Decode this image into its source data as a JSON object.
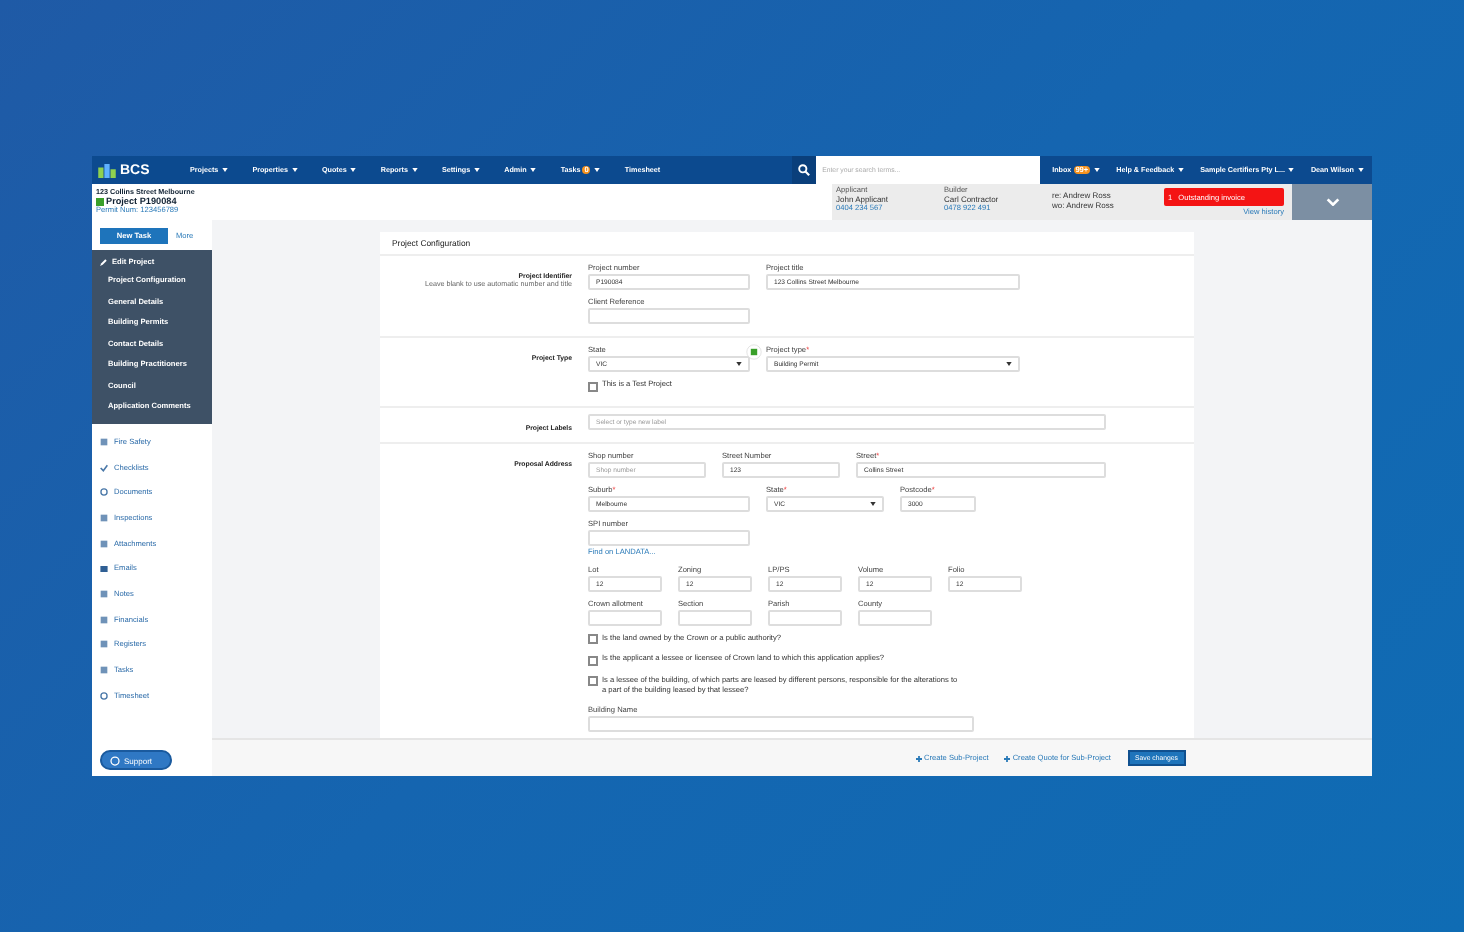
{
  "nav": {
    "logo": "BCS",
    "menu": [
      {
        "label": "Projects",
        "dropdown": true
      },
      {
        "label": "Properties",
        "dropdown": true
      },
      {
        "label": "Quotes",
        "dropdown": true
      },
      {
        "label": "Reports",
        "dropdown": true
      },
      {
        "label": "Settings",
        "dropdown": true
      },
      {
        "label": "Admin",
        "dropdown": true
      },
      {
        "label": "Tasks",
        "badge": "0",
        "dropdown": true
      },
      {
        "label": "Timesheet",
        "dropdown": false
      }
    ],
    "search": {
      "placeholder": "Enter your search terms..."
    },
    "right": [
      {
        "label": "Inbox",
        "badge": "99+"
      },
      {
        "label": "Help & Feedback"
      },
      {
        "label": "Sample Certifiers Pty L..."
      },
      {
        "label": "Dean Wilson"
      }
    ]
  },
  "project": {
    "address": "123 Collins Street Melbourne",
    "number": "Project P190084",
    "permit": "Permit Num: 123456789"
  },
  "contacts": [
    {
      "role": "Applicant",
      "name": "John Applicant",
      "phone": "0404 234 567"
    },
    {
      "role": "Builder",
      "name": "Carl Contractor",
      "phone": "0478 922 491"
    }
  ],
  "assignees": [
    "re: Andrew Ross",
    "wo: Andrew Ross"
  ],
  "alert": {
    "count": "1",
    "label": "Outstanding invoice"
  },
  "view_history": "View history",
  "sidebar": {
    "new_task": "New Task",
    "more": "More",
    "edit_title": "Edit Project",
    "edit_items": [
      "Project Configuration",
      "General Details",
      "Building Permits",
      "Contact Details",
      "Building Practitioners",
      "Council",
      "Application Comments"
    ],
    "items": [
      "Fire Safety",
      "Checklists",
      "Documents",
      "Inspections",
      "Attachments",
      "Emails",
      "Notes",
      "Financials",
      "Registers",
      "Tasks",
      "Timesheet"
    ],
    "support": "Support"
  },
  "form": {
    "title": "Project Configuration",
    "sections": [
      {
        "label": "Project Identifier",
        "hint": "Leave blank to use automatic number and title",
        "items": [
          {
            "kind": "fields",
            "fields": [
              {
                "label": "Project number",
                "value": "P190084",
                "kind": "input"
              },
              {
                "label": "Project title",
                "value": "123 Collins Street Melbourne",
                "kind": "input"
              }
            ]
          },
          {
            "kind": "fields",
            "fields": [
              {
                "label": "Client Reference",
                "kind": "input"
              }
            ]
          }
        ]
      },
      {
        "label": "Project Type",
        "items": [
          {
            "kind": "fields",
            "fields": [
              {
                "label": "State",
                "value": "VIC",
                "kind": "select",
                "verified": true
              },
              {
                "label": "Project type",
                "mark": "*",
                "value": "Building Permit",
                "kind": "select"
              }
            ]
          },
          {
            "kind": "checkbox",
            "label": "This is a Test Project",
            "checked": false
          }
        ]
      },
      {
        "label": "Project Labels",
        "items": [
          {
            "kind": "fields",
            "fields": [
              {
                "placeholder": "Select or type new label",
                "kind": "input"
              }
            ]
          }
        ]
      },
      {
        "label": "Proposal Address",
        "items": [
          {
            "kind": "fields",
            "fields": [
              {
                "label": "Shop number",
                "placeholder": "Shop number",
                "kind": "input"
              },
              {
                "label": "Street Number",
                "value": "123",
                "kind": "input"
              },
              {
                "label": "Street",
                "mark": "*",
                "value": "Collins Street",
                "kind": "input"
              }
            ]
          },
          {
            "kind": "fields",
            "fields": [
              {
                "label": "Suburb",
                "mark": "*",
                "value": "Melbourne",
                "kind": "input"
              },
              {
                "label": "State",
                "mark": "*",
                "value": "VIC",
                "kind": "select"
              },
              {
                "label": "Postcode",
                "mark": "*",
                "value": "3000",
                "kind": "input"
              }
            ]
          },
          {
            "kind": "fields",
            "fields": [
              {
                "label": "SPI number",
                "kind": "input"
              }
            ]
          },
          {
            "kind": "link",
            "label": "Find on LANDATA..."
          },
          {
            "kind": "fields",
            "fields": [
              {
                "label": "Lot",
                "value": "12",
                "kind": "input"
              },
              {
                "label": "Zoning",
                "value": "12",
                "kind": "input"
              },
              {
                "label": "LP/PS",
                "value": "12",
                "kind": "input"
              },
              {
                "label": "Volume",
                "value": "12",
                "kind": "input"
              },
              {
                "label": "Folio",
                "value": "12",
                "kind": "input"
              }
            ]
          },
          {
            "kind": "fields",
            "fields": [
              {
                "label": "Crown allotment",
                "kind": "input"
              },
              {
                "label": "Section",
                "kind": "input"
              },
              {
                "label": "Parish",
                "kind": "input"
              },
              {
                "label": "County",
                "kind": "input"
              }
            ]
          },
          {
            "kind": "checkbox",
            "label": "Is the land owned by the Crown or a public authority?",
            "checked": false
          },
          {
            "kind": "checkbox",
            "label": "Is the applicant a lessee or licensee of Crown land to which this application applies?",
            "checked": false
          },
          {
            "kind": "checkbox",
            "label": "Is a lessee of the building, of which parts are leased by different persons, responsible for the alterations to a part of the building leased by that lessee?",
            "checked": false
          },
          {
            "kind": "fields",
            "fields": [
              {
                "label": "Building Name",
                "kind": "input"
              }
            ]
          }
        ]
      }
    ]
  },
  "footer": {
    "links": [
      "Create Sub-Project",
      "Create Quote for Sub-Project"
    ],
    "save": "Save changes"
  }
}
